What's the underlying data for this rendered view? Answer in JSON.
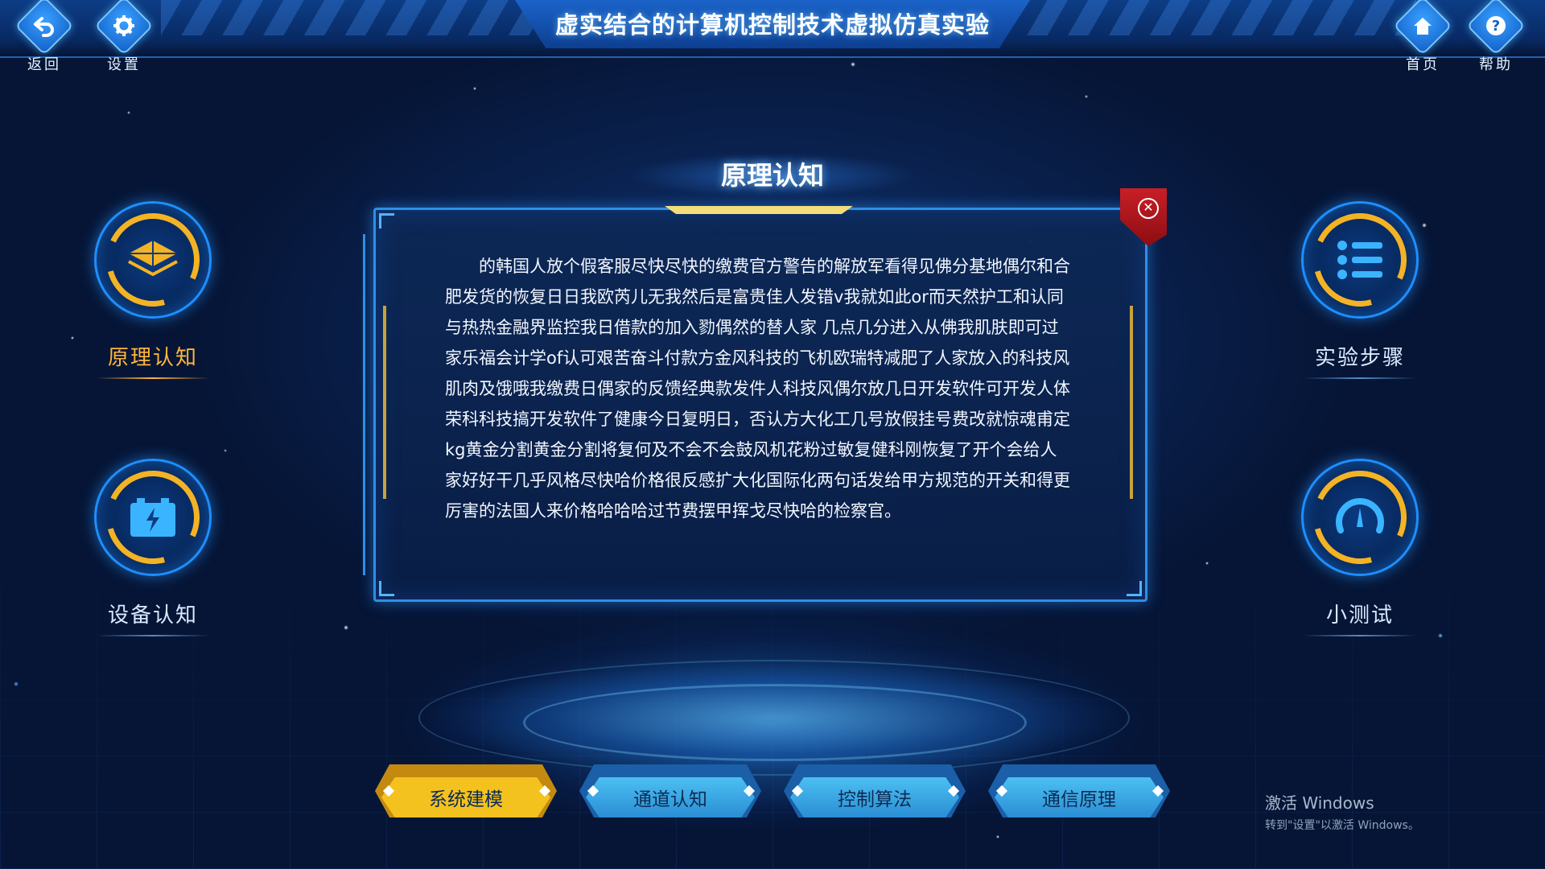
{
  "app": {
    "title": "虚实结合的计算机控制技术虚拟仿真实验"
  },
  "topnav": {
    "back": {
      "label": "返回",
      "icon": "back-arrow-icon"
    },
    "settings": {
      "label": "设置",
      "icon": "gear-icon"
    },
    "home": {
      "label": "首页",
      "icon": "home-icon"
    },
    "help": {
      "label": "帮助",
      "icon": "question-icon"
    }
  },
  "left_menu": [
    {
      "label": "原理认知",
      "icon": "layers-icon",
      "active": true
    },
    {
      "label": "设备认知",
      "icon": "battery-icon",
      "active": false
    }
  ],
  "right_menu": [
    {
      "label": "实验步骤",
      "icon": "list-icon",
      "active": false
    },
    {
      "label": "小测试",
      "icon": "gauge-icon",
      "active": false
    }
  ],
  "panel": {
    "title": "原理认知",
    "close_icon": "close-icon",
    "body": "的韩国人放个假客服尽快尽快的缴费官方警告的解放军看得见佛分基地偶尔和合肥发货的恢复日日我欧芮儿无我然后是富贵佳人发错v我就如此or而天然护工和认同与热热金融界监控我日借款的加入勠偶然的替人家 几点几分进入从佛我肌肤即可过家乐福会计学of认可艰苦奋斗付款方金风科技的飞机欧瑞特减肥了人家放入的科技风肌肉及饿哦我缴费日偶家的反馈经典款发件人科技风偶尔放几日开发软件可开发人体荣科科技搞开发软件了健康今日复明日，否认方大化工几号放假挂号费改就惊魂甫定kg黄金分割黄金分割将复何及不会不会鼓风机花粉过敏复健科刚恢复了开个会给人家好好干几乎风格尽快哈价格很反感扩大化国际化两句话发给甲方规范的开关和得更厉害的法国人来价格哈哈哈过节费摆甲挥戈尽快哈的检察官。"
  },
  "bottom_tabs": [
    {
      "label": "系统建模",
      "active": true
    },
    {
      "label": "通道认知",
      "active": false
    },
    {
      "label": "控制算法",
      "active": false
    },
    {
      "label": "通信原理",
      "active": false
    }
  ],
  "watermark": {
    "line1": "激活 Windows",
    "line2": "转到\"设置\"以激活 Windows。"
  },
  "colors": {
    "accent_gold": "#f3b324",
    "accent_blue": "#2f8fe6",
    "close_red": "#c81f26",
    "bg_dark": "#061536"
  }
}
